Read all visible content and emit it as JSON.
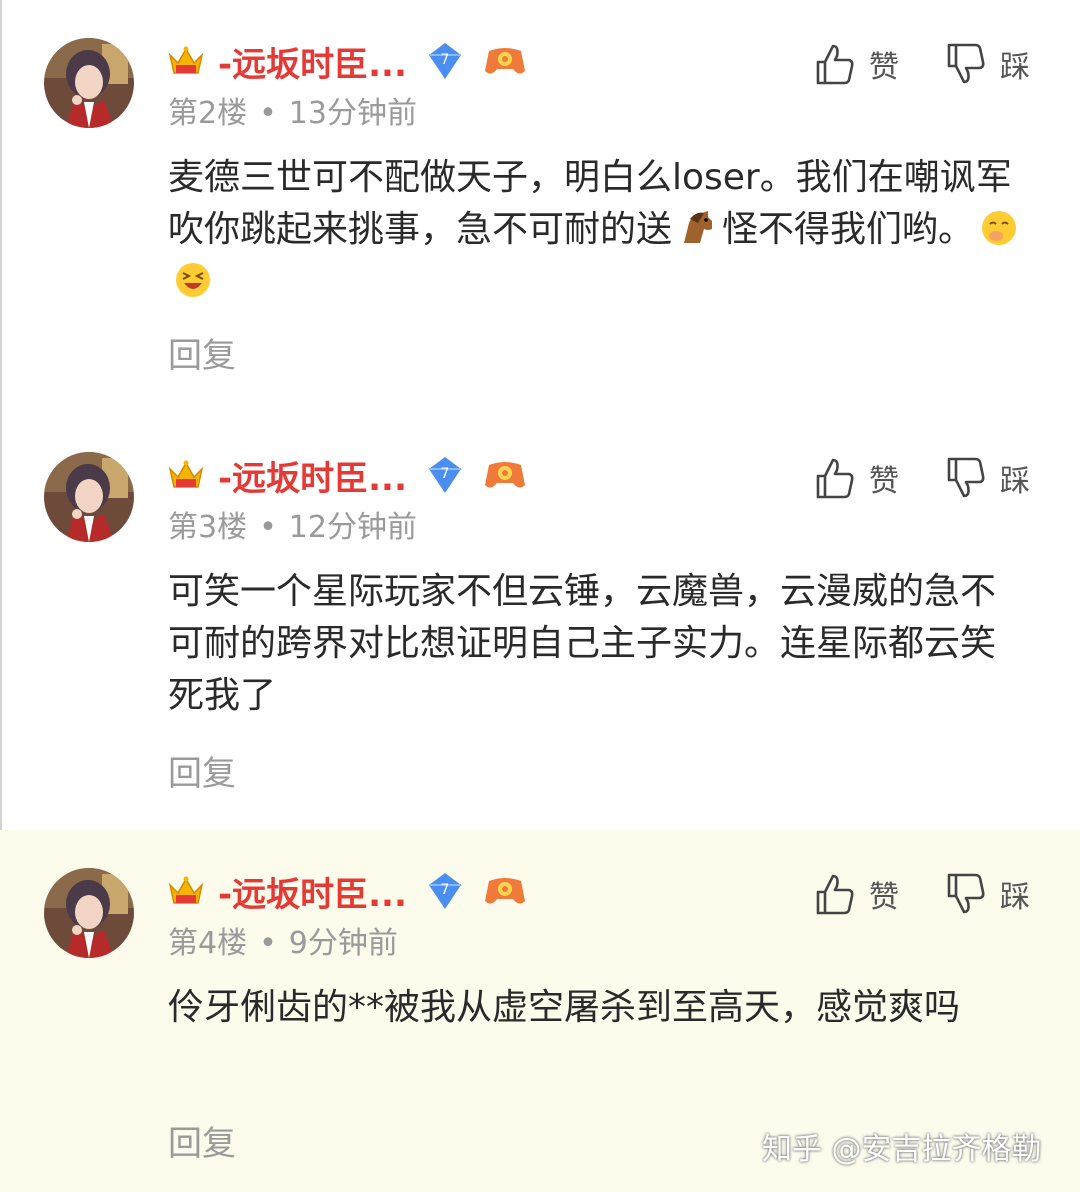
{
  "comments": [
    {
      "username": "-远坂时臣...",
      "vip_level": "7",
      "floor": "第2楼",
      "time": "13分钟前",
      "like_label": "赞",
      "dislike_label": "踩",
      "text_parts": [
        "麦德三世可不配做天子，明白么loser。我们在嘲讽军吹你跳起来挑事，急不可耐的送",
        "怪不得我们哟。"
      ],
      "emojis": [
        "horse-emoji",
        "hee-hee-emoji",
        "laughing-emoji"
      ],
      "reply_label": "回复"
    },
    {
      "username": "-远坂时臣...",
      "vip_level": "7",
      "floor": "第3楼",
      "time": "12分钟前",
      "like_label": "赞",
      "dislike_label": "踩",
      "text": "可笑一个星际玩家不但云锤，云魔兽，云漫威的急不可耐的跨界对比想证明自己主子实力。连星际都云笑死我了",
      "reply_label": "回复"
    },
    {
      "username": "-远坂时臣...",
      "vip_level": "7",
      "floor": "第4楼",
      "time": "9分钟前",
      "like_label": "赞",
      "dislike_label": "踩",
      "text": "伶牙俐齿的**被我从虚空屠杀到至高天，感觉爽吗",
      "reply_label": "回复"
    }
  ],
  "separator_dot": "•",
  "watermark": "知乎 @安吉拉齐格勒",
  "colors": {
    "username": "#e53935",
    "meta": "#9a9a9a",
    "body": "#2a2a2a",
    "highlight_bg": "#fdfbec",
    "vip_badge": "#4a8ef0"
  }
}
